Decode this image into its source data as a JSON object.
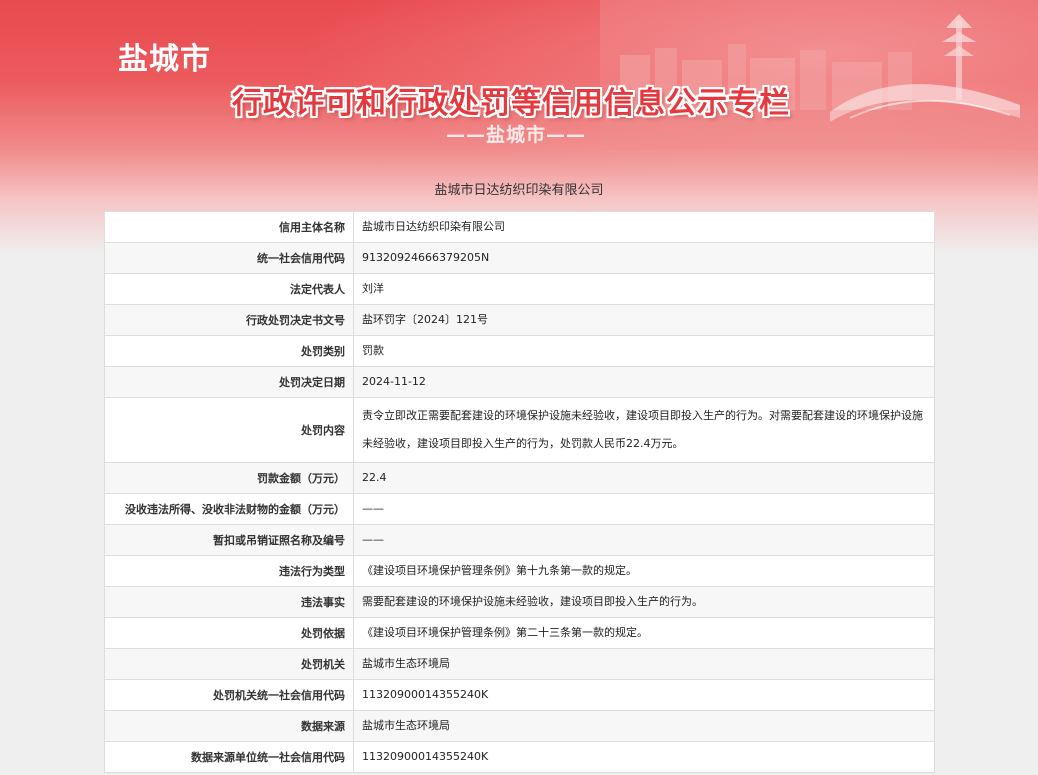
{
  "header": {
    "city_name": "盐城市",
    "main_title": "行政许可和行政处罚等信用信息公示专栏",
    "sub_title": "——盐城市——"
  },
  "company_heading": "盐城市日达纺织印染有限公司",
  "rows": [
    {
      "label": "信用主体名称",
      "value": "盐城市日达纺织印染有限公司"
    },
    {
      "label": "统一社会信用代码",
      "value": "91320924666379205N"
    },
    {
      "label": "法定代表人",
      "value": "刘洋"
    },
    {
      "label": "行政处罚决定书文号",
      "value": "盐环罚字〔2024〕121号"
    },
    {
      "label": "处罚类别",
      "value": "罚款"
    },
    {
      "label": "处罚决定日期",
      "value": "2024-11-12"
    },
    {
      "label": "处罚内容",
      "value": "责令立即改正需要配套建设的环境保护设施未经验收，建设项目即投入生产的行为。对需要配套建设的环境保护设施未经验收，建设项目即投入生产的行为，处罚款人民币22.4万元。"
    },
    {
      "label": "罚款金额（万元）",
      "value": "22.4"
    },
    {
      "label": "没收违法所得、没收非法财物的金额（万元）",
      "value": "——"
    },
    {
      "label": "暂扣或吊销证照名称及编号",
      "value": "——"
    },
    {
      "label": "违法行为类型",
      "value": "《建设项目环境保护管理条例》第十九条第一款的规定。"
    },
    {
      "label": "违法事实",
      "value": "需要配套建设的环境保护设施未经验收，建设项目即投入生产的行为。"
    },
    {
      "label": "处罚依据",
      "value": "《建设项目环境保护管理条例》第二十三条第一款的规定。"
    },
    {
      "label": "处罚机关",
      "value": "盐城市生态环境局"
    },
    {
      "label": "处罚机关统一社会信用代码",
      "value": "11320900014355240K"
    },
    {
      "label": "数据来源",
      "value": "盐城市生态环境局"
    },
    {
      "label": "数据来源单位统一社会信用代码",
      "value": "11320900014355240K"
    }
  ]
}
